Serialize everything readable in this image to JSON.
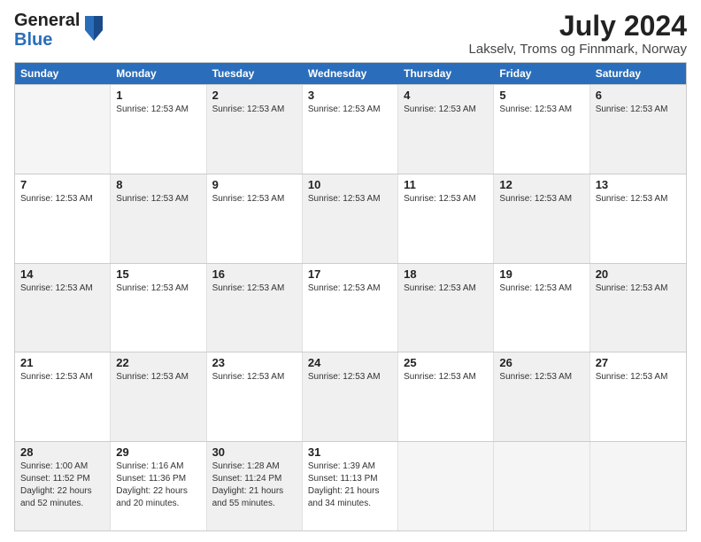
{
  "logo": {
    "line1": "General",
    "line2": "Blue"
  },
  "title": "July 2024",
  "subtitle": "Lakselv, Troms og Finnmark, Norway",
  "header_days": [
    "Sunday",
    "Monday",
    "Tuesday",
    "Wednesday",
    "Thursday",
    "Friday",
    "Saturday"
  ],
  "weeks": [
    {
      "cells": [
        {
          "day": "",
          "info": [],
          "empty": true
        },
        {
          "day": "1",
          "info": [
            "Sunrise: 12:53 AM"
          ],
          "shaded": false
        },
        {
          "day": "2",
          "info": [
            "Sunrise: 12:53 AM"
          ],
          "shaded": true
        },
        {
          "day": "3",
          "info": [
            "Sunrise: 12:53 AM"
          ],
          "shaded": false
        },
        {
          "day": "4",
          "info": [
            "Sunrise: 12:53 AM"
          ],
          "shaded": true
        },
        {
          "day": "5",
          "info": [
            "Sunrise: 12:53 AM"
          ],
          "shaded": false
        },
        {
          "day": "6",
          "info": [
            "Sunrise: 12:53 AM"
          ],
          "shaded": true
        }
      ]
    },
    {
      "cells": [
        {
          "day": "7",
          "info": [
            "Sunrise: 12:53 AM"
          ],
          "shaded": false
        },
        {
          "day": "8",
          "info": [
            "Sunrise: 12:53 AM"
          ],
          "shaded": true
        },
        {
          "day": "9",
          "info": [
            "Sunrise: 12:53 AM"
          ],
          "shaded": false
        },
        {
          "day": "10",
          "info": [
            "Sunrise: 12:53 AM"
          ],
          "shaded": true
        },
        {
          "day": "11",
          "info": [
            "Sunrise: 12:53 AM"
          ],
          "shaded": false
        },
        {
          "day": "12",
          "info": [
            "Sunrise: 12:53 AM"
          ],
          "shaded": true
        },
        {
          "day": "13",
          "info": [
            "Sunrise: 12:53 AM"
          ],
          "shaded": false
        }
      ]
    },
    {
      "cells": [
        {
          "day": "14",
          "info": [
            "Sunrise: 12:53 AM"
          ],
          "shaded": true
        },
        {
          "day": "15",
          "info": [
            "Sunrise: 12:53 AM"
          ],
          "shaded": false
        },
        {
          "day": "16",
          "info": [
            "Sunrise: 12:53 AM"
          ],
          "shaded": true
        },
        {
          "day": "17",
          "info": [
            "Sunrise: 12:53 AM"
          ],
          "shaded": false
        },
        {
          "day": "18",
          "info": [
            "Sunrise: 12:53 AM"
          ],
          "shaded": true
        },
        {
          "day": "19",
          "info": [
            "Sunrise: 12:53 AM"
          ],
          "shaded": false
        },
        {
          "day": "20",
          "info": [
            "Sunrise: 12:53 AM"
          ],
          "shaded": true
        }
      ]
    },
    {
      "cells": [
        {
          "day": "21",
          "info": [
            "Sunrise: 12:53 AM"
          ],
          "shaded": false
        },
        {
          "day": "22",
          "info": [
            "Sunrise: 12:53 AM"
          ],
          "shaded": true
        },
        {
          "day": "23",
          "info": [
            "Sunrise: 12:53 AM"
          ],
          "shaded": false
        },
        {
          "day": "24",
          "info": [
            "Sunrise: 12:53 AM"
          ],
          "shaded": true
        },
        {
          "day": "25",
          "info": [
            "Sunrise: 12:53 AM"
          ],
          "shaded": false
        },
        {
          "day": "26",
          "info": [
            "Sunrise: 12:53 AM"
          ],
          "shaded": true
        },
        {
          "day": "27",
          "info": [
            "Sunrise: 12:53 AM"
          ],
          "shaded": false
        }
      ]
    },
    {
      "cells": [
        {
          "day": "28",
          "info": [
            "Sunrise: 1:00 AM",
            "Sunset: 11:52 PM",
            "Daylight: 22 hours and 52 minutes."
          ],
          "shaded": true
        },
        {
          "day": "29",
          "info": [
            "Sunrise: 1:16 AM",
            "Sunset: 11:36 PM",
            "Daylight: 22 hours and 20 minutes."
          ],
          "shaded": false
        },
        {
          "day": "30",
          "info": [
            "Sunrise: 1:28 AM",
            "Sunset: 11:24 PM",
            "Daylight: 21 hours and 55 minutes."
          ],
          "shaded": true
        },
        {
          "day": "31",
          "info": [
            "Sunrise: 1:39 AM",
            "Sunset: 11:13 PM",
            "Daylight: 21 hours and 34 minutes."
          ],
          "shaded": false
        },
        {
          "day": "",
          "info": [],
          "empty": true
        },
        {
          "day": "",
          "info": [],
          "empty": true
        },
        {
          "day": "",
          "info": [],
          "empty": true
        }
      ]
    }
  ]
}
